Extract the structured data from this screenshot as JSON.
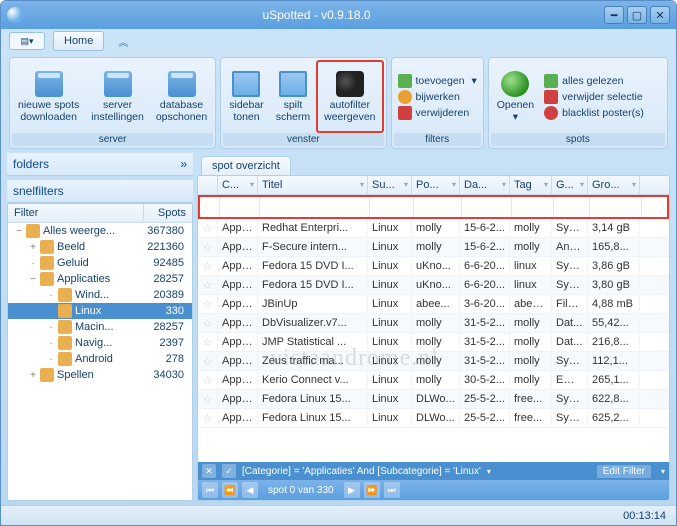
{
  "window": {
    "title": "uSpotted - v0.9.18.0"
  },
  "menubar": {
    "home": "Home"
  },
  "ribbon": {
    "server": {
      "label": "server",
      "download": "nieuwe spots\ndownloaden",
      "settings": "server\ninstellingen",
      "cleanup": "database\nopschonen"
    },
    "venster": {
      "label": "venster",
      "sidebar": "sidebar\ntonen",
      "split": "spilt\nscherm",
      "autofilter": "autofilter\nweergeven"
    },
    "filters": {
      "label": "filters",
      "add": "toevoegen",
      "update": "bijwerken",
      "remove": "verwijderen"
    },
    "spots": {
      "label": "spots",
      "open": "Openen",
      "allread": "alles gelezen",
      "delsel": "verwijder selectie",
      "blacklist": "blacklist poster(s)"
    }
  },
  "sidebar": {
    "folders": "folders",
    "snelfilters": "snelfilters",
    "cols": {
      "filter": "Filter",
      "spots": "Spots"
    },
    "tree": [
      {
        "label": "Alles weerge...",
        "count": "367380",
        "indent": 0,
        "exp": "−"
      },
      {
        "label": "Beeld",
        "count": "221360",
        "indent": 1,
        "exp": "+"
      },
      {
        "label": "Geluid",
        "count": "92485",
        "indent": 1,
        "exp": "·"
      },
      {
        "label": "Applicaties",
        "count": "28257",
        "indent": 1,
        "exp": "−"
      },
      {
        "label": "Wind...",
        "count": "20389",
        "indent": 2,
        "exp": "·"
      },
      {
        "label": "Linux",
        "count": "330",
        "indent": 2,
        "exp": "·",
        "sel": true
      },
      {
        "label": "Macin...",
        "count": "28257",
        "indent": 2,
        "exp": "·"
      },
      {
        "label": "Navig...",
        "count": "2397",
        "indent": 2,
        "exp": "·"
      },
      {
        "label": "Android",
        "count": "278",
        "indent": 2,
        "exp": "·"
      },
      {
        "label": "Spellen",
        "count": "34030",
        "indent": 1,
        "exp": "+"
      }
    ]
  },
  "grid": {
    "tab": "spot overzicht",
    "cols": {
      "cat": "C...",
      "title": "Titel",
      "sub": "Su...",
      "post": "Po...",
      "date": "Da...",
      "tag": "Tag",
      "genre": "G...",
      "size": "Gro..."
    },
    "rows": [
      {
        "cat": "Appl...",
        "title": "Redhat Enterpri...",
        "sub": "Linux",
        "post": "molly",
        "date": "15-6-2...",
        "tag": "molly",
        "genre": "Syst...",
        "size": "3,14 gB"
      },
      {
        "cat": "Appl...",
        "title": "F-Secure intern...",
        "sub": "Linux",
        "post": "molly",
        "date": "15-6-2...",
        "tag": "molly",
        "genre": "Anti...",
        "size": "165,8..."
      },
      {
        "cat": "Appl...",
        "title": "Fedora 15 DVD I...",
        "sub": "Linux",
        "post": "uKno...",
        "date": "6-6-20...",
        "tag": "linux",
        "genre": "Syst...",
        "size": "3,86 gB"
      },
      {
        "cat": "Appl...",
        "title": "Fedora 15 DVD I...",
        "sub": "Linux",
        "post": "uKno...",
        "date": "6-6-20...",
        "tag": "linux",
        "genre": "Syst...",
        "size": "3,80 gB"
      },
      {
        "cat": "Appl...",
        "title": "JBinUp",
        "sub": "Linux",
        "post": "abee...",
        "date": "3-6-20...",
        "tag": "abee...",
        "genre": "File ...",
        "size": "4,88 mB"
      },
      {
        "cat": "Appl...",
        "title": "DbVisualizer.v7...",
        "sub": "Linux",
        "post": "molly",
        "date": "31-5-2...",
        "tag": "molly",
        "genre": "Dat...",
        "size": "55,42..."
      },
      {
        "cat": "Appl...",
        "title": "JMP Statistical ...",
        "sub": "Linux",
        "post": "molly",
        "date": "31-5-2...",
        "tag": "molly",
        "genre": "Dat...",
        "size": "216,8..."
      },
      {
        "cat": "Appl...",
        "title": "Zeus traffic ma...",
        "sub": "Linux",
        "post": "molly",
        "date": "31-5-2...",
        "tag": "molly",
        "genre": "Syst...",
        "size": "112,1..."
      },
      {
        "cat": "Appl...",
        "title": "Kerio Connect v...",
        "sub": "Linux",
        "post": "molly",
        "date": "30-5-2...",
        "tag": "molly",
        "genre": "Ema...",
        "size": "265,1..."
      },
      {
        "cat": "Appl...",
        "title": "Fedora Linux 15...",
        "sub": "Linux",
        "post": "DLWo...",
        "date": "25-5-2...",
        "tag": "free...",
        "genre": "Syst...",
        "size": "622,8..."
      },
      {
        "cat": "Appl...",
        "title": "Fedora Linux 15...",
        "sub": "Linux",
        "post": "DLWo...",
        "date": "25-5-2...",
        "tag": "free...",
        "genre": "Syst...",
        "size": "625,2..."
      }
    ],
    "filter_expr": "[Categorie] = 'Applicaties' And [Subcategorie] = 'Linux'",
    "edit_filter": "Edit Filter",
    "nav_status": "spot 0 van 330"
  },
  "status": {
    "time": "00:13:14"
  },
  "watermark": "vistaandrome.nl"
}
